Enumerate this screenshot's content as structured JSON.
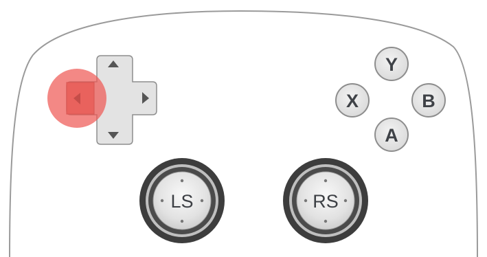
{
  "controller": {
    "face_buttons": {
      "y": "Y",
      "x": "X",
      "b": "B",
      "a": "A"
    },
    "sticks": {
      "left": "LS",
      "right": "RS"
    },
    "dpad": {
      "pressed": "left"
    },
    "colors": {
      "body_outline": "#9a9a9a",
      "button_fill": "#e3e3e3",
      "button_stroke": "#8d8d8d",
      "highlight": "#ef5a56"
    }
  }
}
